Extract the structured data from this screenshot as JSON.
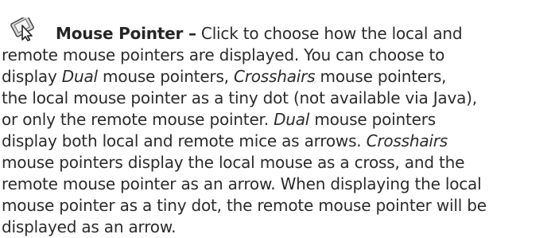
{
  "icon": "mouse-pointer-icon",
  "heading": "Mouse Pointer –",
  "lines": {
    "l1": " Click to choose how the local and",
    "l2": "remote mouse pointers are displayed. You can choose to",
    "l3a": "display ",
    "l3b": "Dual",
    "l3c": " mouse pointers, ",
    "l3d": "Crosshairs",
    "l3e": " mouse pointers,",
    "l4": "the local mouse pointer as a tiny dot (not available via Java),",
    "l5a": "or only the remote mouse pointer. ",
    "l5b": "Dual",
    "l5c": " mouse pointers",
    "l6a": "display both local and remote mice as arrows. ",
    "l6b": "Crosshairs",
    "l7": "mouse pointers display the local mouse as a cross, and the",
    "l8": "remote mouse pointer as an arrow. When displaying the local",
    "l9": "mouse pointer as a tiny dot, the remote mouse pointer will be",
    "l10": "displayed as an arrow."
  }
}
